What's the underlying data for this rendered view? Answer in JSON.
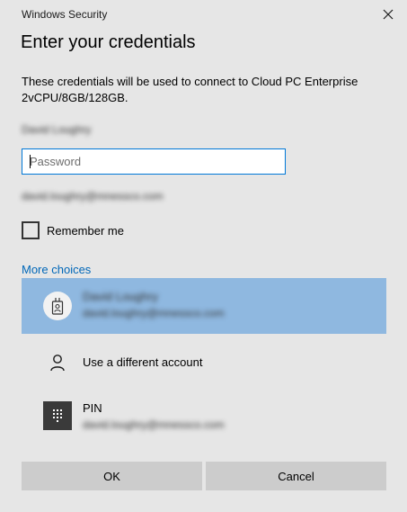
{
  "window": {
    "title": "Windows Security"
  },
  "dialog": {
    "heading": "Enter your credentials",
    "description": "These credentials will be used to connect to Cloud PC Enterprise 2vCPU/8GB/128GB.",
    "username_display": "David Loughry",
    "password_placeholder": "Password",
    "password_value": "",
    "email_display": "david.loughry@mnessco.com",
    "remember_label": "Remember me",
    "remember_checked": false,
    "more_choices_label": "More choices"
  },
  "choices": [
    {
      "icon": "badge-icon",
      "name": "David Loughry",
      "detail": "david.loughry@mnessco.com",
      "selected": true
    },
    {
      "icon": "person-icon",
      "name": "Use a different account",
      "selected": false
    },
    {
      "icon": "pin-keypad-icon",
      "name": "PIN",
      "detail": "david.loughry@mnessco.com",
      "selected": false
    }
  ],
  "buttons": {
    "ok": "OK",
    "cancel": "Cancel"
  },
  "colors": {
    "background": "#e6e6e6",
    "accent_link": "#0067b8",
    "input_focus_border": "#0078d7",
    "selected_choice": "#8fb8e0",
    "button_bg": "#cccccc"
  }
}
